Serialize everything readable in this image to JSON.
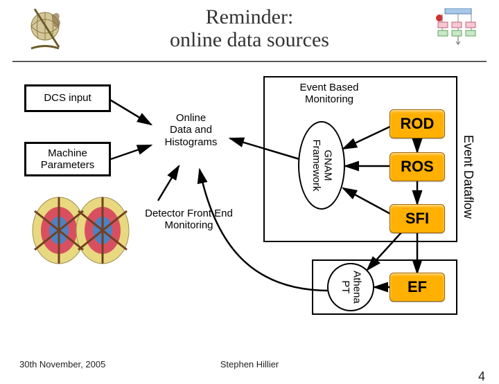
{
  "title": "Reminder:\nonline data sources",
  "boxes": {
    "dcs_input": "DCS input",
    "machine_params": "Machine\nParameters",
    "online_data": "Online\nData and\nHistograms",
    "event_monitoring": "Event Based\nMonitoring",
    "detector_fe": "Detector Front End\nMonitoring"
  },
  "stages": {
    "rod": "ROD",
    "ros": "ROS",
    "sfi": "SFI",
    "ef": "EF"
  },
  "ovals": {
    "gnam": "GNAM\nFramework",
    "athena": "Athena\nPT"
  },
  "event_dataflow": "Event Dataflow",
  "footer": {
    "date": "30th November, 2005",
    "author": "Stephen Hillier",
    "page": "4"
  }
}
